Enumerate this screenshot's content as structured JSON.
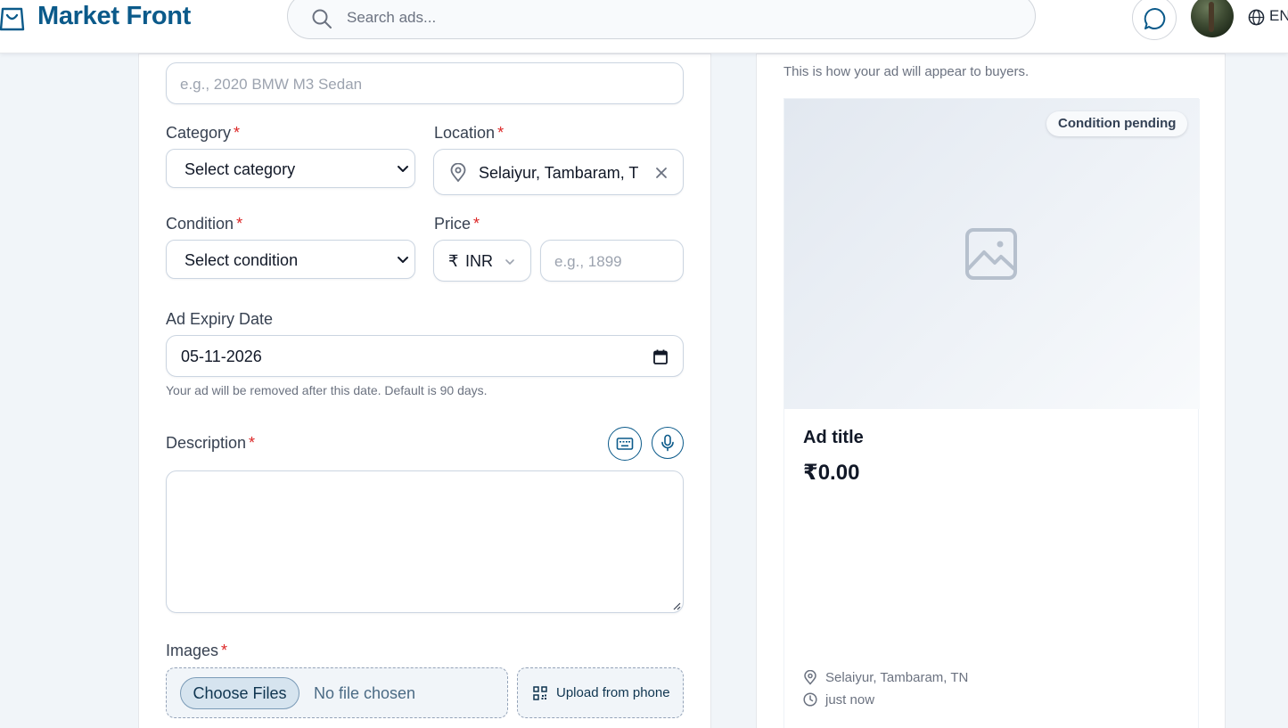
{
  "header": {
    "brand": "Market Front",
    "search_placeholder": "Search ads...",
    "language": "EN"
  },
  "form": {
    "title_placeholder": "e.g., 2020 BMW M3 Sedan",
    "category": {
      "label": "Category",
      "value": "Select category"
    },
    "location": {
      "label": "Location",
      "value": "Selaiyur, Tambaram, TN"
    },
    "condition": {
      "label": "Condition",
      "value": "Select condition"
    },
    "price": {
      "label": "Price",
      "currency_symbol": "₹",
      "currency": "INR",
      "placeholder": "e.g., 1899"
    },
    "expiry": {
      "label": "Ad Expiry Date",
      "value": "05-11-2026",
      "hint": "Your ad will be removed after this date. Default is 90 days."
    },
    "description": {
      "label": "Description",
      "value": ""
    },
    "images": {
      "label": "Images",
      "choose_label": "Choose Files",
      "no_file_text": "No file chosen",
      "upload_phone_label": "Upload from phone"
    },
    "required_mark": "*"
  },
  "preview": {
    "note": "This is how your ad will appear to buyers.",
    "badge": "Condition pending",
    "title": "Ad title",
    "price": "₹0.00",
    "location": "Selaiyur, Tambaram, TN",
    "time": "just now"
  },
  "colors": {
    "brand": "#0b5a8a",
    "required": "#dc2626",
    "page_bg": "#f1f5f9"
  },
  "icons": [
    "shopping-bag-icon",
    "search-icon",
    "chat-bubble-icon",
    "globe-icon",
    "map-pin-icon",
    "clear-icon",
    "chevron-down-icon",
    "calendar-icon",
    "keyboard-icon",
    "microphone-icon",
    "qr-code-icon",
    "image-placeholder-icon",
    "clock-icon"
  ]
}
